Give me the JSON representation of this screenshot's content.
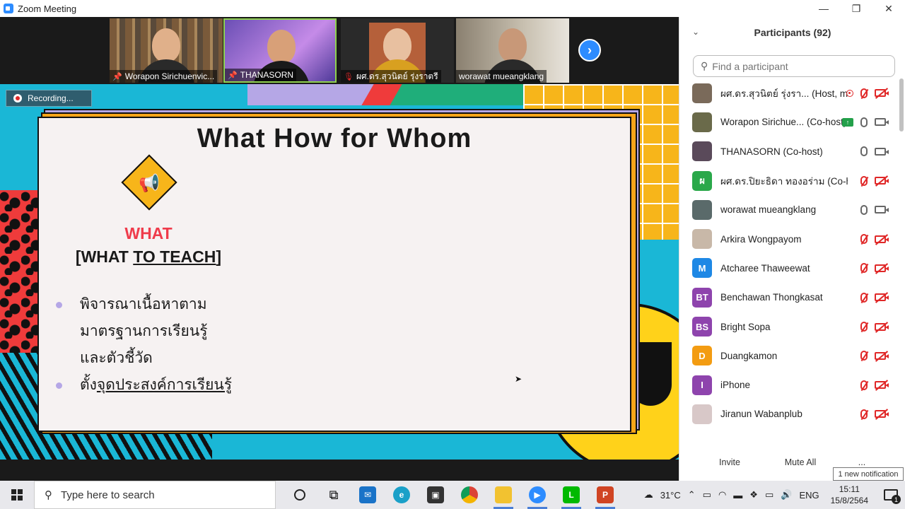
{
  "window": {
    "title": "Zoom Meeting"
  },
  "gallery": {
    "tiles": [
      {
        "name": "Worapon Sirichuenvic...",
        "pinned": true,
        "muted": false
      },
      {
        "name": "THANASORN",
        "pinned": true,
        "muted": false
      },
      {
        "name": "ผศ.ดร.สุวนิตย์ รุ่งราตรี",
        "pinned": false,
        "muted": true
      },
      {
        "name": "worawat mueangklang",
        "pinned": false,
        "muted": false
      }
    ]
  },
  "recording": {
    "label": "Recording..."
  },
  "slide": {
    "title": "What How for Whom",
    "what_heading": "WHAT",
    "what_sub_open": "[WHAT ",
    "what_sub_underlined": "TO TEACH",
    "what_sub_close": "]",
    "bullets": [
      {
        "lines": [
          "พิจารณาเนื้อหาตาม",
          "มาตรฐานการเรียนรู้",
          "และตัวชี้วัด"
        ]
      },
      {
        "prefix": "ตั้ง",
        "underlined": "จุดประสงค์การเรียนรู้"
      }
    ]
  },
  "participants": {
    "header": "Participants (92)",
    "search_placeholder": "Find a participant",
    "items": [
      {
        "name": "ผศ.ดร.สุวนิตย์ รุ่งรา... (Host, me)",
        "avatar": "photo",
        "avatar_color": "#7a6a5a",
        "recording": true,
        "mic": "off",
        "cam": "off"
      },
      {
        "name": "Worapon Sirichue... (Co-host)",
        "avatar": "photo",
        "avatar_color": "#6a6a4a",
        "sharing": true,
        "mic": "on",
        "cam": "on"
      },
      {
        "name": "THANASORN (Co-host)",
        "avatar": "photo",
        "avatar_color": "#5a4a5a",
        "mic": "on",
        "cam": "on"
      },
      {
        "name": "ผศ.ดร.ปิยะธิดา ทองอร่าม (Co-host)",
        "avatar": "ผ",
        "avatar_color": "#2aa84a",
        "mic": "off",
        "cam": "off"
      },
      {
        "name": "worawat mueangklang",
        "avatar": "photo",
        "avatar_color": "#5a6a6a",
        "mic": "on",
        "cam": "on"
      },
      {
        "name": "Arkira Wongpayom",
        "avatar": "photo",
        "avatar_color": "#c8b8a8",
        "mic": "off",
        "cam": "off"
      },
      {
        "name": "Atcharee Thaweewat",
        "avatar": "M",
        "avatar_color": "#1e88e5",
        "mic": "off",
        "cam": "off"
      },
      {
        "name": "Benchawan Thongkasat",
        "avatar": "BT",
        "avatar_color": "#8e44ad",
        "mic": "off",
        "cam": "off"
      },
      {
        "name": "Bright Sopa",
        "avatar": "BS",
        "avatar_color": "#8e44ad",
        "mic": "off",
        "cam": "off"
      },
      {
        "name": "Duangkamon",
        "avatar": "D",
        "avatar_color": "#f39c12",
        "mic": "off",
        "cam": "off"
      },
      {
        "name": "iPhone",
        "avatar": "I",
        "avatar_color": "#8e44ad",
        "mic": "off",
        "cam": "off"
      },
      {
        "name": "Jiranun Wabanplub",
        "avatar": "photo",
        "avatar_color": "#d8c8c8",
        "mic": "off",
        "cam": "off"
      }
    ],
    "invite_label": "Invite",
    "mute_all_label": "Mute All",
    "more_label": "..."
  },
  "notification": {
    "label": "1 new notification"
  },
  "taskbar": {
    "search_placeholder": "Type here to search",
    "temperature": "31°C",
    "language": "ENG",
    "time": "15:11",
    "date": "15/8/2564",
    "notification_count": "1"
  }
}
